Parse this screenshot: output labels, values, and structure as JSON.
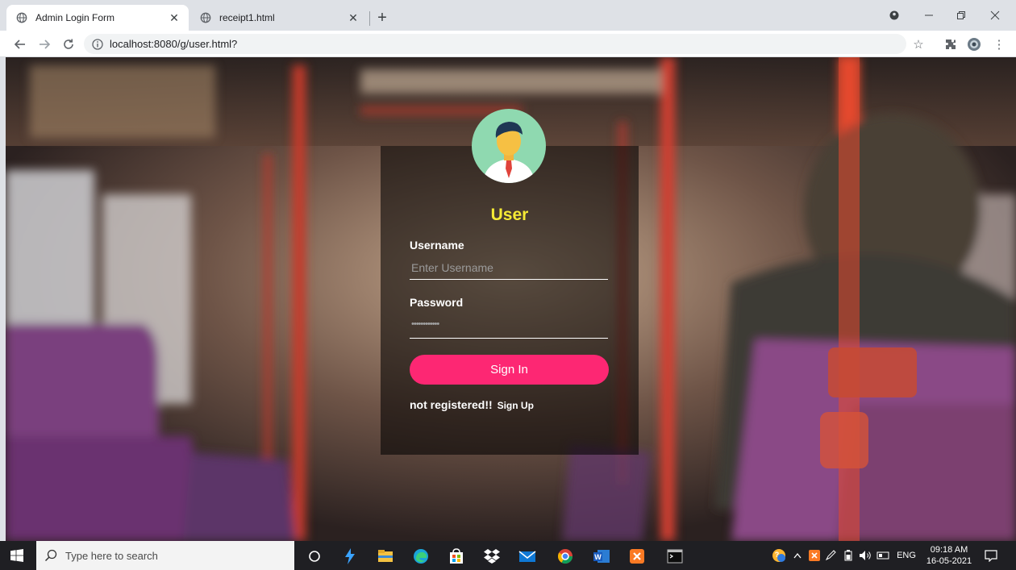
{
  "browser": {
    "tabs": [
      {
        "title": "Admin Login Form",
        "active": true
      },
      {
        "title": "receipt1.html",
        "active": false
      }
    ],
    "new_tab_label": "+",
    "address_url": "localhost:8080/g/user.html?"
  },
  "login_form": {
    "heading": "User",
    "username_label": "Username",
    "username_placeholder": "Enter Username",
    "password_label": "Password",
    "password_value": "••••••••••••",
    "submit_label": "Sign In",
    "register_prompt": "not registered!!",
    "register_link": "Sign Up"
  },
  "taskbar": {
    "search_placeholder": "Type here to search",
    "language": "ENG",
    "time": "09:18 AM",
    "date": "16-05-2021"
  },
  "colors": {
    "heading": "#f5ea35",
    "button": "#fd2773",
    "card": "rgba(0,0,0,0.56)"
  },
  "icons": [
    "globe-icon",
    "close-icon",
    "back-icon",
    "forward-icon",
    "reload-icon",
    "info-icon",
    "star-icon",
    "extensions-icon",
    "profile-icon",
    "menu-icon",
    "user-avatar-icon",
    "windows-start-icon",
    "search-icon"
  ]
}
